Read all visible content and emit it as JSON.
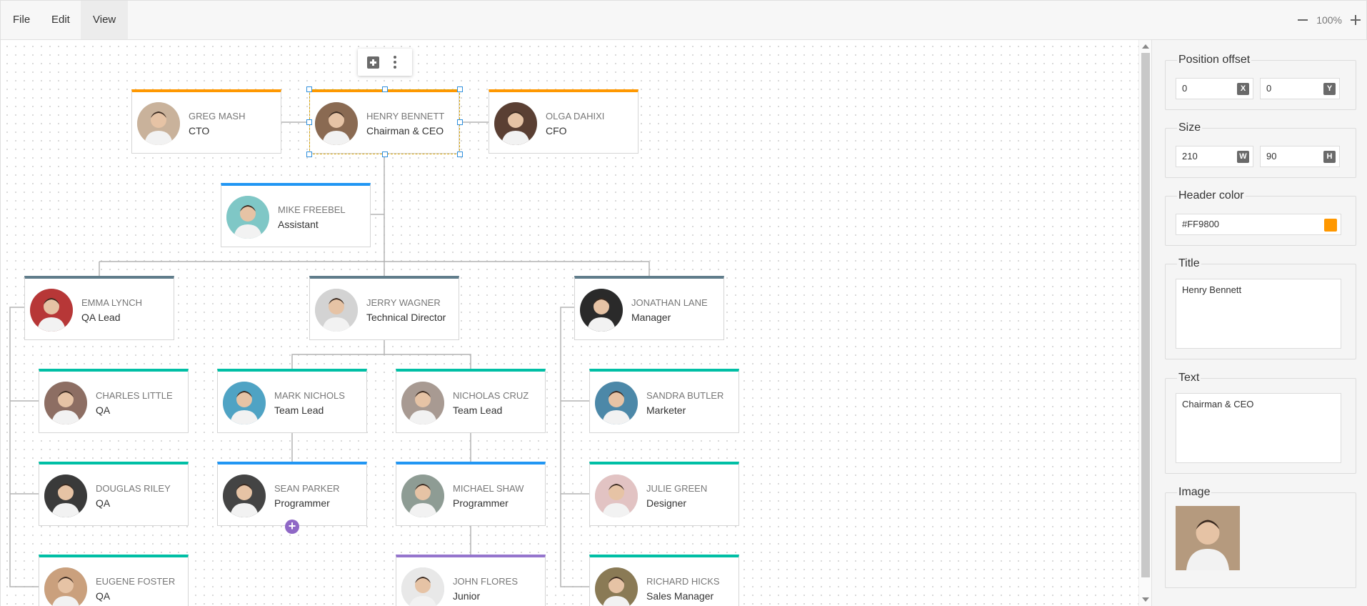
{
  "menu": {
    "file": "File",
    "edit": "Edit",
    "view": "View"
  },
  "zoom": {
    "value": "100%",
    "minus_icon": "minus-icon",
    "plus_icon": "plus-icon"
  },
  "context_toolbar": {
    "icons": [
      "add-square-icon",
      "more-vertical-icon"
    ]
  },
  "nodes": [
    {
      "id": "greg",
      "name": "GREG MASH",
      "role": "CTO",
      "color": "#FF9800",
      "photo": "#c9b29b"
    },
    {
      "id": "henry",
      "name": "HENRY BENNETT",
      "role": "Chairman & CEO",
      "color": "#FF9800",
      "photo": "#8a6a52",
      "selected": true
    },
    {
      "id": "olga",
      "name": "OLGA DAHIXI",
      "role": "CFO",
      "color": "#FF9800",
      "photo": "#5a3f33"
    },
    {
      "id": "mike",
      "name": "MIKE FREEBEL",
      "role": "Assistant",
      "color": "#2196F3",
      "photo": "#7fc7c6"
    },
    {
      "id": "emma",
      "name": "EMMA LYNCH",
      "role": "QA Lead",
      "color": "#607D8B",
      "photo": "#b73737"
    },
    {
      "id": "jerry",
      "name": "JERRY WAGNER",
      "role": "Technical Director",
      "color": "#607D8B",
      "photo": "#d3d3d3"
    },
    {
      "id": "jonathan",
      "name": "JONATHAN LANE",
      "role": "Manager",
      "color": "#607D8B",
      "photo": "#2a2a2a"
    },
    {
      "id": "charles",
      "name": "CHARLES LITTLE",
      "role": "QA",
      "color": "#00BFA5",
      "photo": "#8d6e63"
    },
    {
      "id": "mark",
      "name": "MARK NICHOLS",
      "role": "Team Lead",
      "color": "#00BFA5",
      "photo": "#4fa3c4"
    },
    {
      "id": "nicholas",
      "name": "NICHOLAS CRUZ",
      "role": "Team Lead",
      "color": "#00BFA5",
      "photo": "#a89a92"
    },
    {
      "id": "sandra",
      "name": "SANDRA BUTLER",
      "role": "Marketer",
      "color": "#00BFA5",
      "photo": "#4c88a8"
    },
    {
      "id": "douglas",
      "name": "DOUGLAS RILEY",
      "role": "QA",
      "color": "#00BFA5",
      "photo": "#3a3a3a"
    },
    {
      "id": "sean",
      "name": "SEAN PARKER",
      "role": "Programmer",
      "color": "#2196F3",
      "photo": "#444444"
    },
    {
      "id": "michael",
      "name": "MICHAEL SHAW",
      "role": "Programmer",
      "color": "#2196F3",
      "photo": "#8e9c94"
    },
    {
      "id": "julie",
      "name": "JULIE GREEN",
      "role": "Designer",
      "color": "#00BFA5",
      "photo": "#e2c3c3"
    },
    {
      "id": "eugene",
      "name": "EUGENE FOSTER",
      "role": "QA",
      "color": "#00BFA5",
      "photo": "#caa07d"
    },
    {
      "id": "john",
      "name": "JOHN FLORES",
      "role": "Junior",
      "color": "#9575CD",
      "photo": "#e8e8e8"
    },
    {
      "id": "richard",
      "name": "RICHARD HICKS",
      "role": "Sales Manager",
      "color": "#00BFA5",
      "photo": "#8a7a55"
    }
  ],
  "panel": {
    "position_offset": {
      "label": "Position offset",
      "x": "0",
      "x_tag": "X",
      "y": "0",
      "y_tag": "Y"
    },
    "size": {
      "label": "Size",
      "w": "210",
      "w_tag": "W",
      "h": "90",
      "h_tag": "H"
    },
    "header_color": {
      "label": "Header color",
      "value": "#FF9800",
      "swatch": "#FF9800"
    },
    "title": {
      "label": "Title",
      "value": "Henry Bennett"
    },
    "text": {
      "label": "Text",
      "value": "Chairman & CEO"
    },
    "image": {
      "label": "Image",
      "photo": "#b59a7e"
    }
  }
}
